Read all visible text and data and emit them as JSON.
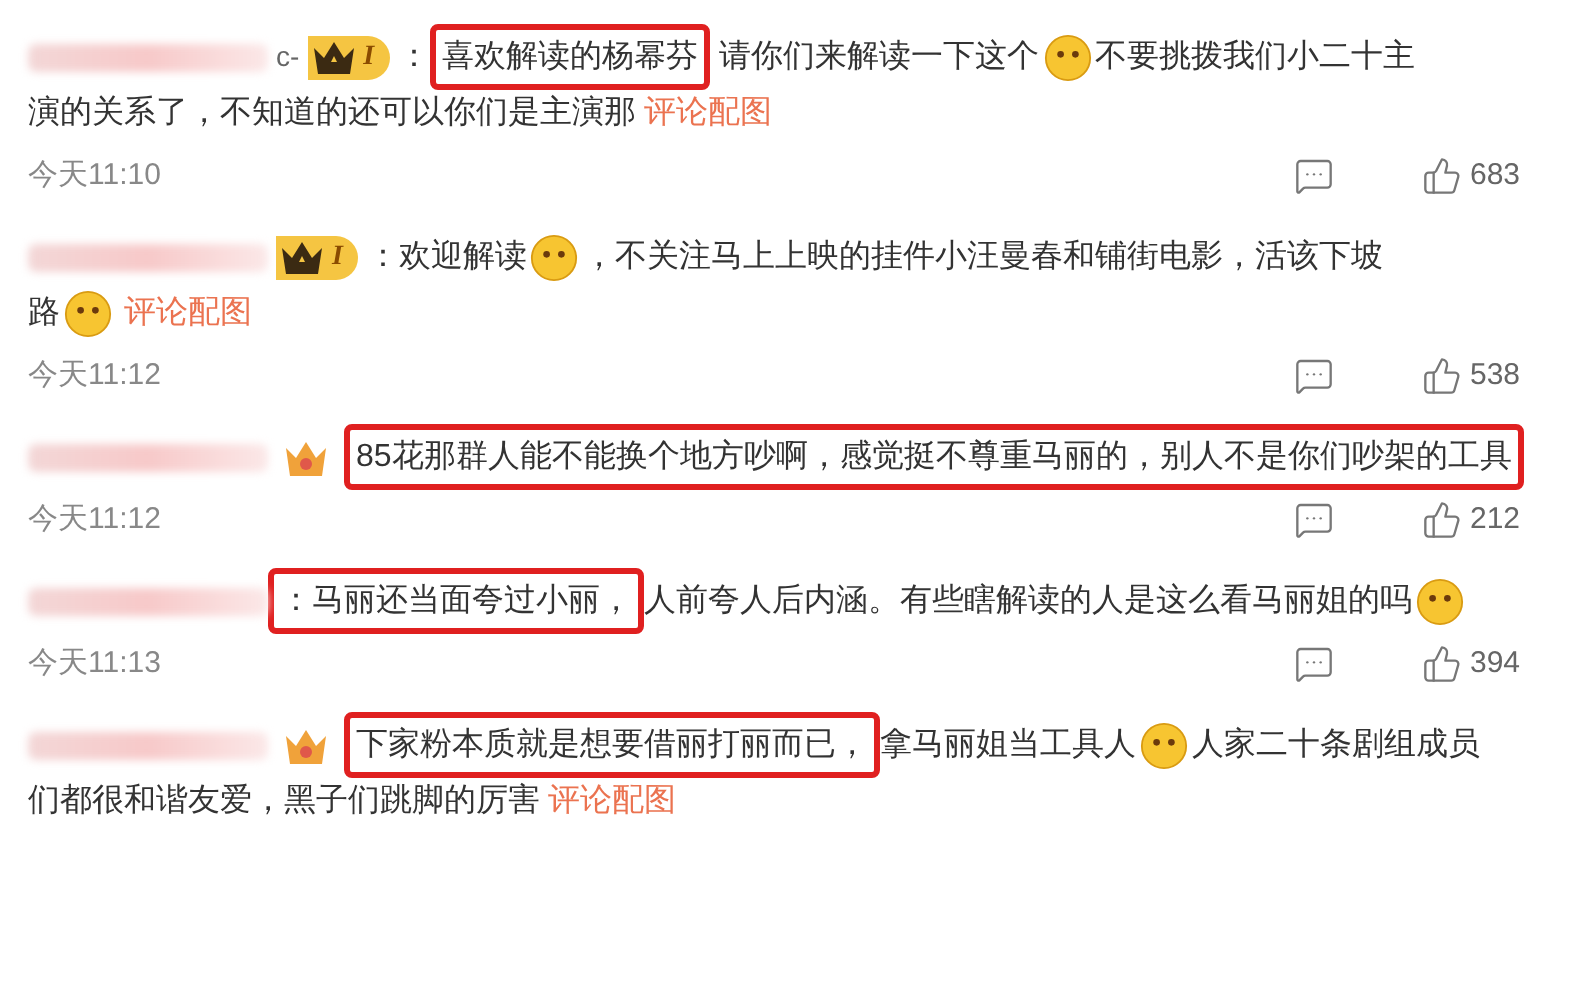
{
  "comments": [
    {
      "username_tail": "c-",
      "badge": {
        "kind": "vip",
        "level": "I"
      },
      "lines": [
        [
          {
            "kind": "text",
            "text": "：",
            "highlighted": false
          },
          {
            "kind": "text",
            "text": "喜欢解读的杨幂芬",
            "highlighted": true
          },
          {
            "kind": "text",
            "text": " 请你们来解读一下这个",
            "highlighted": false
          },
          {
            "kind": "emoji"
          },
          {
            "kind": "text",
            "text": "不要挑拨我们小二十主",
            "highlighted": false
          }
        ],
        [
          {
            "kind": "text",
            "text": "演的关系了，不知道的还可以你们是主演那",
            "highlighted": false
          },
          {
            "kind": "link",
            "text": "评论配图"
          }
        ]
      ],
      "time": "今天11:10",
      "likes": "683"
    },
    {
      "badge": {
        "kind": "vip",
        "level": "I"
      },
      "lines": [
        [
          {
            "kind": "text",
            "text": "：欢迎解读",
            "highlighted": false
          },
          {
            "kind": "emoji"
          },
          {
            "kind": "text",
            "text": "，不关注马上上映的挂件小汪曼春和铺街电影，活该下坡",
            "highlighted": false
          }
        ],
        [
          {
            "kind": "text",
            "text": "路",
            "highlighted": false
          },
          {
            "kind": "emoji"
          },
          {
            "kind": "link",
            "text": "评论配图"
          }
        ]
      ],
      "time": "今天11:12",
      "likes": "538"
    },
    {
      "badge": {
        "kind": "crown"
      },
      "lines": [
        [
          {
            "kind": "text",
            "text": "85花那群人能不能换个地方吵啊，感觉挺不尊重马丽的，别人不是你们吵架的工具",
            "highlighted": true
          }
        ]
      ],
      "time": "今天11:12",
      "likes": "212"
    },
    {
      "badge": {
        "kind": "none"
      },
      "lines": [
        [
          {
            "kind": "text",
            "text": "：马丽还当面夸过小丽，",
            "highlighted": true
          },
          {
            "kind": "text",
            "text": "人前夸人后内涵。有些瞎解读的人是这么看马丽姐的吗",
            "highlighted": false
          },
          {
            "kind": "emoji"
          }
        ]
      ],
      "time": "今天11:13",
      "likes": "394"
    },
    {
      "badge": {
        "kind": "crown"
      },
      "lines": [
        [
          {
            "kind": "text",
            "text": "下家粉本质就是想要借丽打丽而已，",
            "highlighted": true
          },
          {
            "kind": "text",
            "text": "拿马丽姐当工具人",
            "highlighted": false
          },
          {
            "kind": "emoji"
          },
          {
            "kind": "text",
            "text": "人家二十条剧组成员",
            "highlighted": false
          }
        ],
        [
          {
            "kind": "text",
            "text": "们都很和谐友爱，黑子们跳脚的厉害",
            "highlighted": false
          },
          {
            "kind": "link",
            "text": "评论配图"
          }
        ]
      ]
    }
  ]
}
